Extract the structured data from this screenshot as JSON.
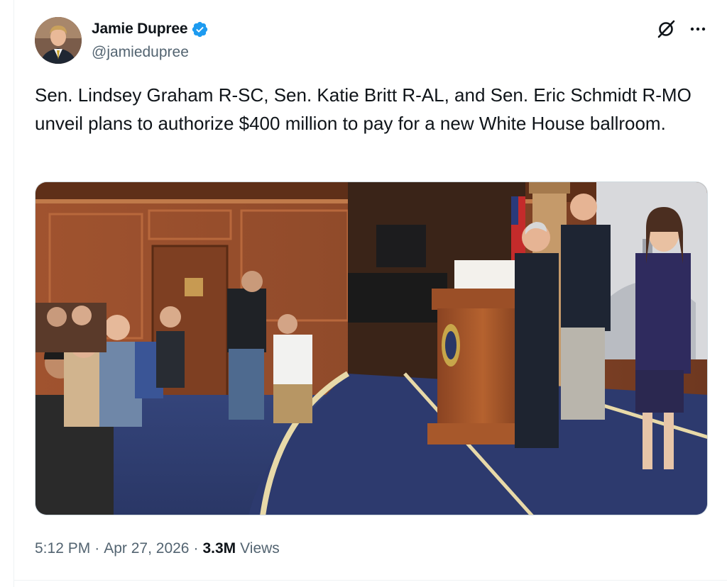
{
  "author": {
    "display_name": "Jamie Dupree",
    "handle": "@jamiedupree",
    "verified": true,
    "verified_color": "#1d9bf0"
  },
  "actions": {
    "grok_icon": "grok-slash-circle-icon",
    "more_icon": "ellipsis-icon"
  },
  "tweet": {
    "text": "Sen. Lindsey Graham R-SC, Sen. Katie Britt R-AL, and Sen. Eric Schmidt R-MO unveil plans to authorize $400 million to pay for a new White House ballroom."
  },
  "meta": {
    "time": "5:12 PM",
    "separator": "·",
    "date": "Apr 27, 2026",
    "views_count": "3.3M",
    "views_label": "Views"
  },
  "colors": {
    "text_primary": "#0f1419",
    "text_secondary": "#536471",
    "border": "#cfd9de"
  }
}
